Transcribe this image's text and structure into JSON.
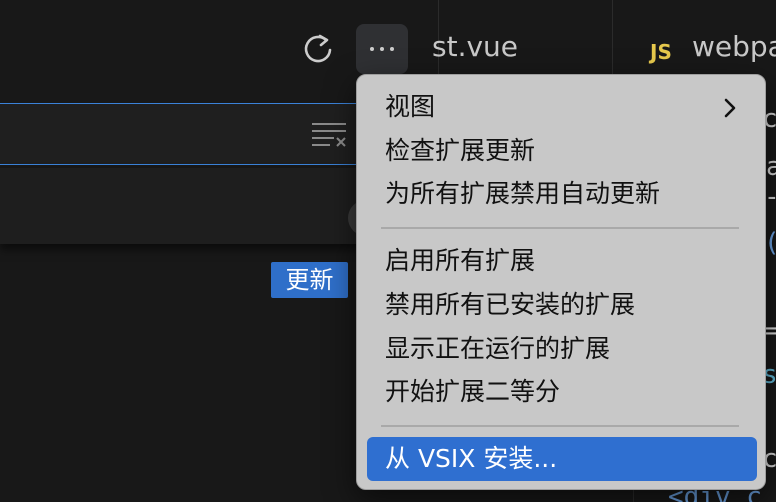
{
  "header": {
    "refresh_icon": "refresh-icon",
    "more_icon": "more-actions-icon"
  },
  "search": {
    "clear_icon": "clear-filter-icon"
  },
  "extension": {
    "update_label": "更新"
  },
  "tabs": [
    {
      "label": "st.vue"
    },
    {
      "icon": "JS",
      "label": "webpa"
    }
  ],
  "editor_fragments": [
    "c",
    "a",
    "-",
    "(",
    "=",
    "s",
    "c",
    "<div c"
  ],
  "menu": {
    "items_group1": [
      {
        "label": "视图",
        "has_submenu": true
      },
      {
        "label": "检查扩展更新"
      },
      {
        "label": "为所有扩展禁用自动更新"
      }
    ],
    "items_group2": [
      {
        "label": "启用所有扩展"
      },
      {
        "label": "禁用所有已安装的扩展"
      },
      {
        "label": "显示正在运行的扩展"
      },
      {
        "label": "开始扩展二等分"
      }
    ],
    "items_group3": [
      {
        "label": "从 VSIX 安装...",
        "highlighted": true
      }
    ]
  },
  "colors": {
    "accent": "#2f6fd0",
    "menu_bg": "#c8c8c8",
    "editor_bg": "#181818"
  }
}
